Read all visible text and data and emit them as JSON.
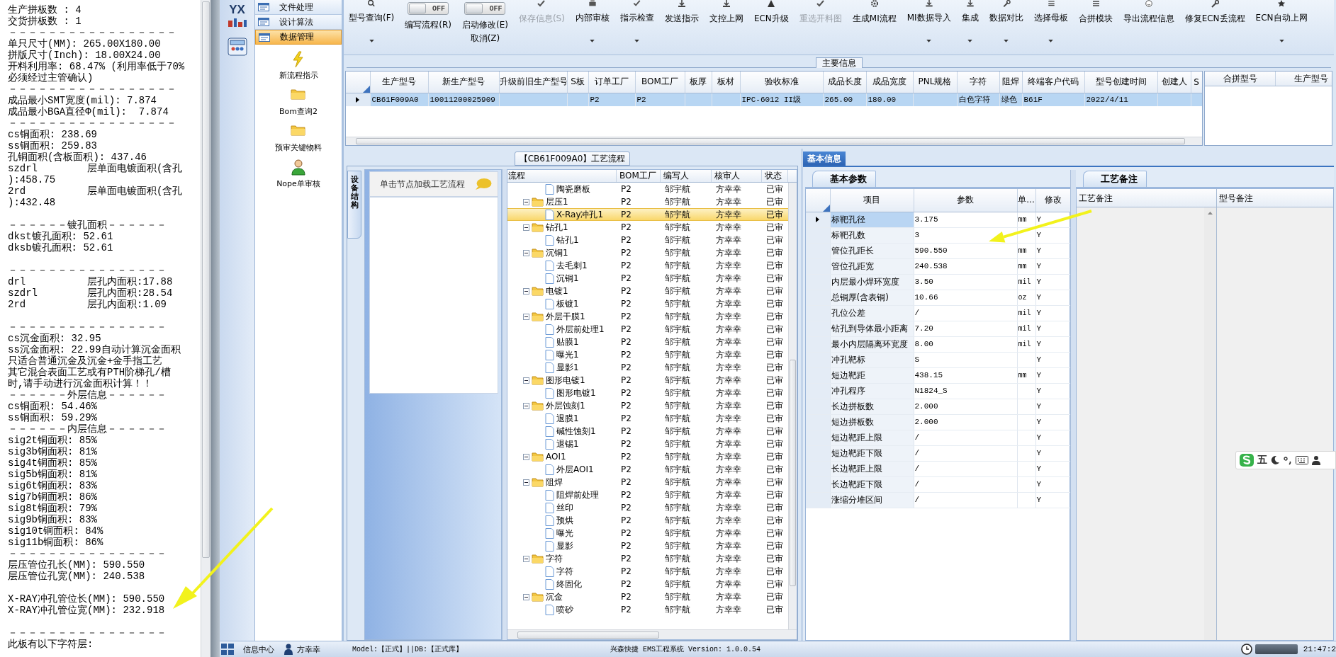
{
  "log_panel": {
    "lines": [
      {
        "kind": "text",
        "text": "生产拼板数 : 4"
      },
      {
        "kind": "text",
        "text": "交货拼板数 : 1"
      },
      {
        "kind": "text",
        "text": "－－－－－－－－－－－－－－－－－"
      },
      {
        "kind": "text",
        "text": "单只尺寸(MM): 265.00X180.00"
      },
      {
        "kind": "text",
        "text": "拼版尺寸(Inch): 18.00X24.00"
      },
      {
        "kind": "text",
        "text": "开料利用率: 68.47% (利用率低于70%"
      },
      {
        "kind": "text",
        "text": "必须经过主管确认)"
      },
      {
        "kind": "text",
        "text": "－－－－－－－－－－－－－－－－－"
      },
      {
        "kind": "text",
        "text": "成品最小SMT宽度(mil): 7.874"
      },
      {
        "kind": "text",
        "text": "成品最小BGA直径Φ(mil):  7.874"
      },
      {
        "kind": "text",
        "text": "－－－－－－－－－－－－－－－－－"
      },
      {
        "kind": "text",
        "text": "cs铜面积: 238.69"
      },
      {
        "kind": "text",
        "text": "ss铜面积: 259.83"
      },
      {
        "kind": "text",
        "text": "孔铜面积(含板面积): 437.46"
      },
      {
        "kind": "pair",
        "label": "szdrl",
        "text": "层单面电镀面积(含孔"
      },
      {
        "kind": "text",
        "text": "):458.75"
      },
      {
        "kind": "pair",
        "label": "2rd",
        "text": "层单面电镀面积(含孔"
      },
      {
        "kind": "text",
        "text": "):432.48"
      },
      {
        "kind": "blank"
      },
      {
        "kind": "text",
        "text": "－－－－－－镀孔面积－－－－－－"
      },
      {
        "kind": "text",
        "text": "dkst镀孔面积: 52.61"
      },
      {
        "kind": "text",
        "text": "dksb镀孔面积: 52.61"
      },
      {
        "kind": "blank"
      },
      {
        "kind": "text",
        "text": "－－－－－－－－－－－－－－－－"
      },
      {
        "kind": "pair",
        "label": "drl",
        "text": "层孔内面积:17.88"
      },
      {
        "kind": "pair",
        "label": "szdrl",
        "text": "层孔内面积:28.54"
      },
      {
        "kind": "pair",
        "label": "2rd",
        "text": "层孔内面积:1.09"
      },
      {
        "kind": "blank"
      },
      {
        "kind": "text",
        "text": "－－－－－－－－－－－－－－－－"
      },
      {
        "kind": "text",
        "text": "cs沉金面积: 32.95"
      },
      {
        "kind": "text",
        "text": "ss沉金面积: 22.99自动计算沉金面积"
      },
      {
        "kind": "text",
        "text": "只适合普通沉金及沉金+金手指工艺"
      },
      {
        "kind": "text",
        "text": "其它混合表面工艺或有PTH阶梯孔/槽"
      },
      {
        "kind": "text",
        "text": "时,请手动进行沉金面积计算！！"
      },
      {
        "kind": "text",
        "text": "－－－－－－外层信息－－－－－－"
      },
      {
        "kind": "text",
        "text": "cs铜面积: 54.46%"
      },
      {
        "kind": "text",
        "text": "ss铜面积: 59.29%"
      },
      {
        "kind": "text",
        "text": "－－－－－－内层信息－－－－－－"
      },
      {
        "kind": "text",
        "text": "sig2t铜面积: 85%"
      },
      {
        "kind": "text",
        "text": "sig3b铜面积: 81%"
      },
      {
        "kind": "text",
        "text": "sig4t铜面积: 85%"
      },
      {
        "kind": "text",
        "text": "sig5b铜面积: 81%"
      },
      {
        "kind": "text",
        "text": "sig6t铜面积: 83%"
      },
      {
        "kind": "text",
        "text": "sig7b铜面积: 86%"
      },
      {
        "kind": "text",
        "text": "sig8t铜面积: 79%"
      },
      {
        "kind": "text",
        "text": "sig9b铜面积: 83%"
      },
      {
        "kind": "text",
        "text": "sig10t铜面积: 84%"
      },
      {
        "kind": "text",
        "text": "sig11b铜面积: 86%"
      },
      {
        "kind": "text",
        "text": "－－－－－－－－－－－－－－－－"
      },
      {
        "kind": "text",
        "text": "层压管位孔长(MM): 590.550"
      },
      {
        "kind": "text",
        "text": "层压管位孔宽(MM): 240.538"
      },
      {
        "kind": "blank"
      },
      {
        "kind": "text",
        "text": "X-RAY冲孔管位长(MM): 590.550"
      },
      {
        "kind": "text",
        "text": "X-RAY冲孔管位宽(MM): 232.918"
      },
      {
        "kind": "blank"
      },
      {
        "kind": "text",
        "text": "－－－－－－－－－－－－－－－－"
      },
      {
        "kind": "text",
        "text": "此板有以下字符层:"
      }
    ]
  },
  "nav": {
    "logo": "YX",
    "menu": [
      {
        "label": "文件处理",
        "selected": false
      },
      {
        "label": "设计算法",
        "selected": false
      },
      {
        "label": "数据管理",
        "selected": true
      }
    ],
    "actions": [
      {
        "label": "新流程指示",
        "kind": "bolt"
      },
      {
        "label": "Bom查询2",
        "kind": "folder"
      },
      {
        "label": "预审关键物料",
        "kind": "folder"
      },
      {
        "label": "Nope单审核",
        "kind": "user"
      }
    ]
  },
  "toolbar": [
    {
      "kind": "button",
      "label": "型号查询(F)",
      "dropdown": true,
      "disabled": false
    },
    {
      "kind": "toggle",
      "label": "编写流程(R)",
      "switch_text": "OFF",
      "on": false
    },
    {
      "kind": "toggle",
      "label": "启动修改(E)",
      "switch_text": "OFF",
      "on": false,
      "extra": "取消(Z)"
    },
    {
      "kind": "button",
      "label": "保存信息(S)",
      "dropdown": false,
      "disabled": true
    },
    {
      "kind": "button",
      "label": "内部审核",
      "dropdown": true,
      "disabled": false
    },
    {
      "kind": "button",
      "label": "指示检查",
      "dropdown": true,
      "disabled": false
    },
    {
      "kind": "button",
      "label": "发送指示",
      "dropdown": false,
      "disabled": false
    },
    {
      "kind": "button",
      "label": "文控上网",
      "dropdown": false,
      "disabled": false
    },
    {
      "kind": "button",
      "label": "ECN升级",
      "dropdown": false,
      "disabled": false
    },
    {
      "kind": "button",
      "label": "重选开料图",
      "dropdown": false,
      "disabled": true
    },
    {
      "kind": "button",
      "label": "生成MI流程",
      "dropdown": false,
      "disabled": false
    },
    {
      "kind": "button",
      "label": "MI数据导入",
      "dropdown": true,
      "disabled": false
    },
    {
      "kind": "button",
      "label": "集成",
      "dropdown": true,
      "disabled": false
    },
    {
      "kind": "button",
      "label": "数据对比",
      "dropdown": true,
      "disabled": false
    },
    {
      "kind": "button",
      "label": "选择母板",
      "dropdown": true,
      "disabled": false
    },
    {
      "kind": "button",
      "label": "合拼模块",
      "dropdown": false,
      "disabled": false
    },
    {
      "kind": "button",
      "label": "导出流程信息",
      "dropdown": false,
      "disabled": false
    },
    {
      "kind": "button",
      "label": "修复ECN丢流程",
      "dropdown": false,
      "disabled": false
    },
    {
      "kind": "button",
      "label": "ECN自动上网",
      "dropdown": true,
      "disabled": false
    }
  ],
  "main_info": {
    "title": "主要信息",
    "columns": [
      "生产型号",
      "新生产型号",
      "升级前旧生产型号",
      "S板",
      "订单工厂",
      "BOM工厂",
      "板厚",
      "板材",
      "验收标准",
      "成品长度",
      "成品宽度",
      "PNL规格",
      "字符",
      "阻焊",
      "终端客户代码",
      "型号创建时间",
      "创建人",
      "S"
    ],
    "rows": [
      {
        "selected": true,
        "cells": [
          "CB61F009A0",
          "10011200025909",
          null,
          null,
          "P2",
          "P2",
          null,
          null,
          "IPC-6012 II级",
          "265.00",
          "180.00",
          null,
          "白色字符",
          "绿色",
          "B61F",
          "2022/4/11",
          null,
          null
        ]
      }
    ],
    "side_columns": [
      "合拼型号",
      "生产型号"
    ]
  },
  "process_flow": {
    "title": "【CB61F009A0】工艺流程",
    "side_tab": "设备结构",
    "hint": "单击节点加载工艺流程",
    "columns": [
      "流程",
      "BOM工厂",
      "编写人",
      "核审人",
      "状态"
    ],
    "rows": [
      {
        "kind": "step",
        "label": "陶瓷磨板",
        "bom": "P2",
        "author": "邹宇航",
        "reviewer": "方幸幸",
        "status": "已审",
        "selected": false
      },
      {
        "kind": "group",
        "label": "层压1",
        "expanded": true,
        "bom": "P2",
        "author": "邹宇航",
        "reviewer": "方幸幸",
        "status": "已审",
        "selected": false,
        "children": [
          {
            "kind": "step",
            "label": "X-Ray冲孔1",
            "bom": "P2",
            "author": "邹宇航",
            "reviewer": "方幸幸",
            "status": "已审",
            "selected": true
          }
        ]
      },
      {
        "kind": "group",
        "label": "钻孔1",
        "expanded": true,
        "bom": "P2",
        "author": "邹宇航",
        "reviewer": "方幸幸",
        "status": "已审",
        "selected": false,
        "children": [
          {
            "kind": "step",
            "label": "钻孔1",
            "bom": "P2",
            "author": "邹宇航",
            "reviewer": "方幸幸",
            "status": "已审",
            "selected": false
          }
        ]
      },
      {
        "kind": "group",
        "label": "沉铜1",
        "expanded": true,
        "bom": "P2",
        "author": "邹宇航",
        "reviewer": "方幸幸",
        "status": "已审",
        "selected": false,
        "children": [
          {
            "kind": "step",
            "label": "去毛刺1",
            "bom": "P2",
            "author": "邹宇航",
            "reviewer": "方幸幸",
            "status": "已审",
            "selected": false
          },
          {
            "kind": "step",
            "label": "沉铜1",
            "bom": "P2",
            "author": "邹宇航",
            "reviewer": "方幸幸",
            "status": "已审",
            "selected": false
          }
        ]
      },
      {
        "kind": "group",
        "label": "电镀1",
        "expanded": true,
        "bom": "P2",
        "author": "邹宇航",
        "reviewer": "方幸幸",
        "status": "已审",
        "selected": false,
        "children": [
          {
            "kind": "step",
            "label": "板镀1",
            "bom": "P2",
            "author": "邹宇航",
            "reviewer": "方幸幸",
            "status": "已审",
            "selected": false
          }
        ]
      },
      {
        "kind": "group",
        "label": "外层干膜1",
        "expanded": true,
        "bom": "P2",
        "author": "邹宇航",
        "reviewer": "方幸幸",
        "status": "已审",
        "selected": false,
        "children": [
          {
            "kind": "step",
            "label": "外层前处理1",
            "bom": "P2",
            "author": "邹宇航",
            "reviewer": "方幸幸",
            "status": "已审",
            "selected": false
          },
          {
            "kind": "step",
            "label": "贴膜1",
            "bom": "P2",
            "author": "邹宇航",
            "reviewer": "方幸幸",
            "status": "已审",
            "selected": false
          },
          {
            "kind": "step",
            "label": "曝光1",
            "bom": "P2",
            "author": "邹宇航",
            "reviewer": "方幸幸",
            "status": "已审",
            "selected": false
          },
          {
            "kind": "step",
            "label": "显影1",
            "bom": "P2",
            "author": "邹宇航",
            "reviewer": "方幸幸",
            "status": "已审",
            "selected": false
          }
        ]
      },
      {
        "kind": "group",
        "label": "图形电镀1",
        "expanded": true,
        "bom": "P2",
        "author": "邹宇航",
        "reviewer": "方幸幸",
        "status": "已审",
        "selected": false,
        "children": [
          {
            "kind": "step",
            "label": "图形电镀1",
            "bom": "P2",
            "author": "邹宇航",
            "reviewer": "方幸幸",
            "status": "已审",
            "selected": false
          }
        ]
      },
      {
        "kind": "group",
        "label": "外层蚀刻1",
        "expanded": true,
        "bom": "P2",
        "author": "邹宇航",
        "reviewer": "方幸幸",
        "status": "已审",
        "selected": false,
        "children": [
          {
            "kind": "step",
            "label": "退膜1",
            "bom": "P2",
            "author": "邹宇航",
            "reviewer": "方幸幸",
            "status": "已审",
            "selected": false
          },
          {
            "kind": "step",
            "label": "碱性蚀刻1",
            "bom": "P2",
            "author": "邹宇航",
            "reviewer": "方幸幸",
            "status": "已审",
            "selected": false
          },
          {
            "kind": "step",
            "label": "退锡1",
            "bom": "P2",
            "author": "邹宇航",
            "reviewer": "方幸幸",
            "status": "已审",
            "selected": false
          }
        ]
      },
      {
        "kind": "group",
        "label": "AOI1",
        "expanded": true,
        "bom": "P2",
        "author": "邹宇航",
        "reviewer": "方幸幸",
        "status": "已审",
        "selected": false,
        "children": [
          {
            "kind": "step",
            "label": "外层AOI1",
            "bom": "P2",
            "author": "邹宇航",
            "reviewer": "方幸幸",
            "status": "已审",
            "selected": false
          }
        ]
      },
      {
        "kind": "group",
        "label": "阻焊",
        "expanded": true,
        "bom": "P2",
        "author": "邹宇航",
        "reviewer": "方幸幸",
        "status": "已审",
        "selected": false,
        "children": [
          {
            "kind": "step",
            "label": "阻焊前处理",
            "bom": "P2",
            "author": "邹宇航",
            "reviewer": "方幸幸",
            "status": "已审",
            "selected": false
          },
          {
            "kind": "step",
            "label": "丝印",
            "bom": "P2",
            "author": "邹宇航",
            "reviewer": "方幸幸",
            "status": "已审",
            "selected": false
          },
          {
            "kind": "step",
            "label": "预烘",
            "bom": "P2",
            "author": "邹宇航",
            "reviewer": "方幸幸",
            "status": "已审",
            "selected": false
          },
          {
            "kind": "step",
            "label": "曝光",
            "bom": "P2",
            "author": "邹宇航",
            "reviewer": "方幸幸",
            "status": "已审",
            "selected": false
          },
          {
            "kind": "step",
            "label": "显影",
            "bom": "P2",
            "author": "邹宇航",
            "reviewer": "方幸幸",
            "status": "已审",
            "selected": false
          }
        ]
      },
      {
        "kind": "group",
        "label": "字符",
        "expanded": true,
        "bom": "P2",
        "author": "邹宇航",
        "reviewer": "方幸幸",
        "status": "已审",
        "selected": false,
        "children": [
          {
            "kind": "step",
            "label": "字符",
            "bom": "P2",
            "author": "邹宇航",
            "reviewer": "方幸幸",
            "status": "已审",
            "selected": false
          },
          {
            "kind": "step",
            "label": "终固化",
            "bom": "P2",
            "author": "邹宇航",
            "reviewer": "方幸幸",
            "status": "已审",
            "selected": false
          }
        ]
      },
      {
        "kind": "group",
        "label": "沉金",
        "expanded": true,
        "bom": "P2",
        "author": "邹宇航",
        "reviewer": "方幸幸",
        "status": "已审",
        "selected": false,
        "children": [
          {
            "kind": "step",
            "label": "喷砂",
            "bom": "P2",
            "author": "邹宇航",
            "reviewer": "方幸幸",
            "status": "已审",
            "selected": false
          }
        ]
      }
    ]
  },
  "basic_info": {
    "tab": "基本信息",
    "subtab": "基本参数",
    "columns": [
      "项目",
      "参数",
      "单...",
      "修改"
    ],
    "rows": [
      {
        "item": "标靶孔径",
        "value": "3.175",
        "unit": "mm",
        "modified": "Y",
        "selected": true
      },
      {
        "item": "标靶孔数",
        "value": "3",
        "unit": null,
        "modified": "Y",
        "selected": false
      },
      {
        "item": "管位孔距长",
        "value": "590.550",
        "unit": "mm",
        "modified": "Y",
        "selected": false
      },
      {
        "item": "管位孔距宽",
        "value": "240.538",
        "unit": "mm",
        "modified": "Y",
        "selected": false
      },
      {
        "item": "内层最小焊环宽度",
        "value": "3.50",
        "unit": "mil",
        "modified": "Y",
        "selected": false
      },
      {
        "item": "总铜厚(含表铜)",
        "value": "10.66",
        "unit": "oz",
        "modified": "Y",
        "selected": false
      },
      {
        "item": "孔位公差",
        "value": "/",
        "unit": "mil",
        "modified": "Y",
        "selected": false
      },
      {
        "item": "钻孔到导体最小距离",
        "value": "7.20",
        "unit": "mil",
        "modified": "Y",
        "selected": false
      },
      {
        "item": "最小内层隔离环宽度",
        "value": "8.00",
        "unit": "mil",
        "modified": "Y",
        "selected": false
      },
      {
        "item": "冲孔靶标",
        "value": "S",
        "unit": null,
        "modified": "Y",
        "selected": false
      },
      {
        "item": "短边靶距",
        "value": "438.15",
        "unit": "mm",
        "modified": "Y",
        "selected": false
      },
      {
        "item": "冲孔程序",
        "value": "N1824_S",
        "unit": null,
        "modified": "Y",
        "selected": false
      },
      {
        "item": "长边拼板数",
        "value": "2.000",
        "unit": null,
        "modified": "Y",
        "selected": false
      },
      {
        "item": "短边拼板数",
        "value": "2.000",
        "unit": null,
        "modified": "Y",
        "selected": false
      },
      {
        "item": "短边靶距上限",
        "value": "/",
        "unit": null,
        "modified": "Y",
        "selected": false
      },
      {
        "item": "短边靶距下限",
        "value": "/",
        "unit": null,
        "modified": "Y",
        "selected": false
      },
      {
        "item": "长边靶距上限",
        "value": "/",
        "unit": null,
        "modified": "Y",
        "selected": false
      },
      {
        "item": "长边靶距下限",
        "value": "/",
        "unit": null,
        "modified": "Y",
        "selected": false
      },
      {
        "item": "涨缩分堆区间",
        "value": "/",
        "unit": null,
        "modified": "Y",
        "selected": false
      }
    ]
  },
  "remarks": {
    "tab": "工艺备注",
    "columns": [
      "工艺备注",
      "型号备注"
    ]
  },
  "ime_bar": {
    "mode": "五"
  },
  "status_bar": {
    "module": "信息中心",
    "user": "方幸幸",
    "env": "Model:【正式】||DB:【正式库】",
    "app": "兴森快捷 EMS工程系统 Version: 1.0.0.54",
    "clock": "21:47:2"
  }
}
